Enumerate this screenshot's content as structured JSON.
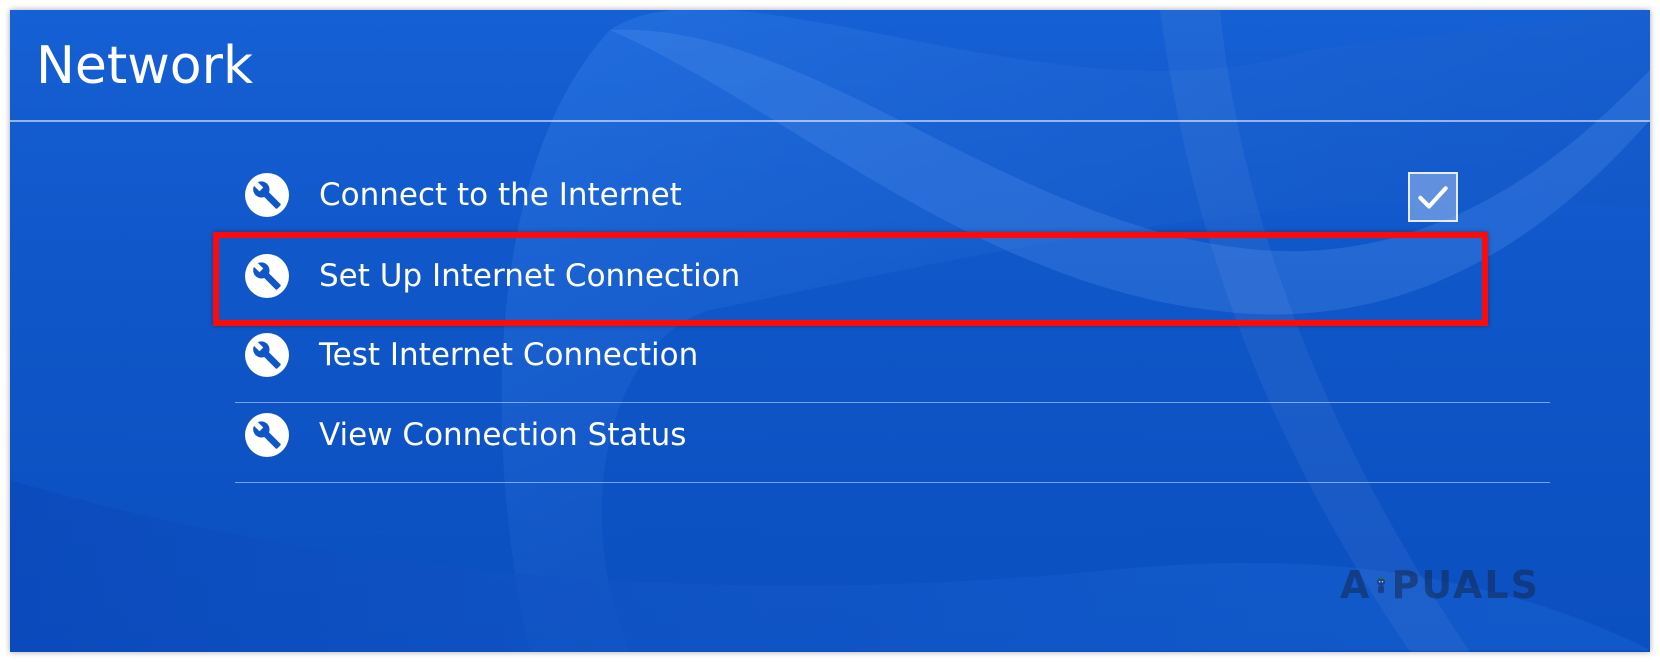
{
  "page": {
    "title": "Network"
  },
  "menu": {
    "items": [
      {
        "label": "Connect to the Internet",
        "icon": "wrench-icon",
        "checked": true
      },
      {
        "label": "Set Up Internet Connection",
        "icon": "wrench-icon",
        "highlighted": true
      },
      {
        "label": "Test Internet Connection",
        "icon": "wrench-icon"
      },
      {
        "label": "View Connection Status",
        "icon": "wrench-icon"
      }
    ]
  },
  "watermark": {
    "prefix": "A",
    "suffix": "PUALS"
  },
  "colors": {
    "background": "#0f56c8",
    "highlight": "#ff0a0a",
    "text": "#ffffff"
  }
}
